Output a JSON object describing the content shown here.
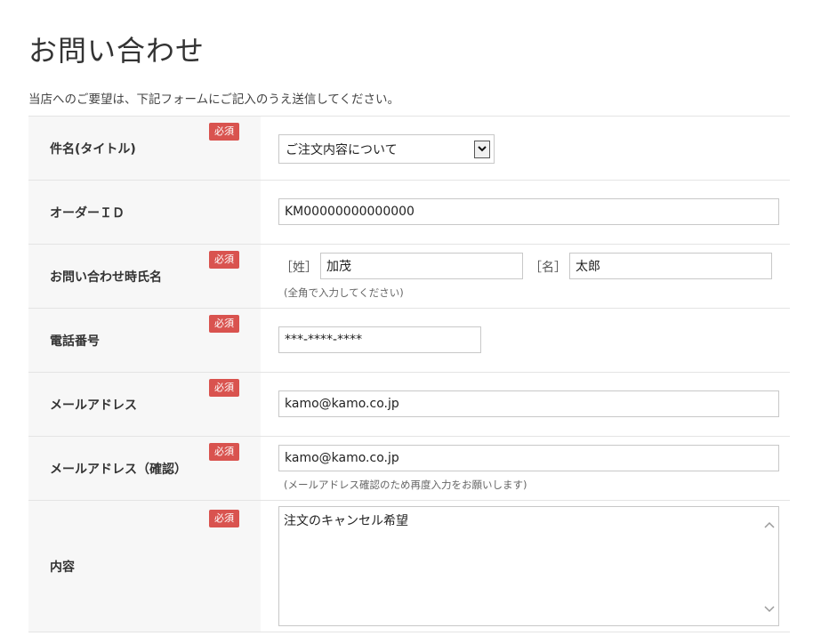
{
  "page": {
    "title": "お問い合わせ",
    "lead": "当店へのご要望は、下記フォームにご記入のうえ送信してください。"
  },
  "form": {
    "required_badge": "必須",
    "subject": {
      "label": "件名(タイトル)",
      "value": "ご注文内容について"
    },
    "order_id": {
      "label": "オーダーＩＤ",
      "value": "KM00000000000000"
    },
    "name": {
      "label": "お問い合わせ時氏名",
      "last_prefix": "［姓］",
      "last_value": "加茂",
      "first_prefix": "［名］",
      "first_value": "太郎",
      "note": "(全角で入力してください)"
    },
    "phone": {
      "label": "電話番号",
      "value": "***-****-****"
    },
    "email": {
      "label": "メールアドレス",
      "value": "kamo@kamo.co.jp"
    },
    "email_confirm": {
      "label": "メールアドレス（確認）",
      "value": "kamo@kamo.co.jp",
      "note": "(メールアドレス確認のため再度入力をお願いします)"
    },
    "content": {
      "label": "内容",
      "value": "注文のキャンセル希望"
    }
  },
  "colors": {
    "badge": "#d9534f",
    "label_bg": "#f7f7f7",
    "border": "#e4e4e4"
  },
  "icons": {
    "select": "chevron-down-icon",
    "scroll_up": "chevron-up-icon",
    "scroll_down": "chevron-down-icon"
  }
}
